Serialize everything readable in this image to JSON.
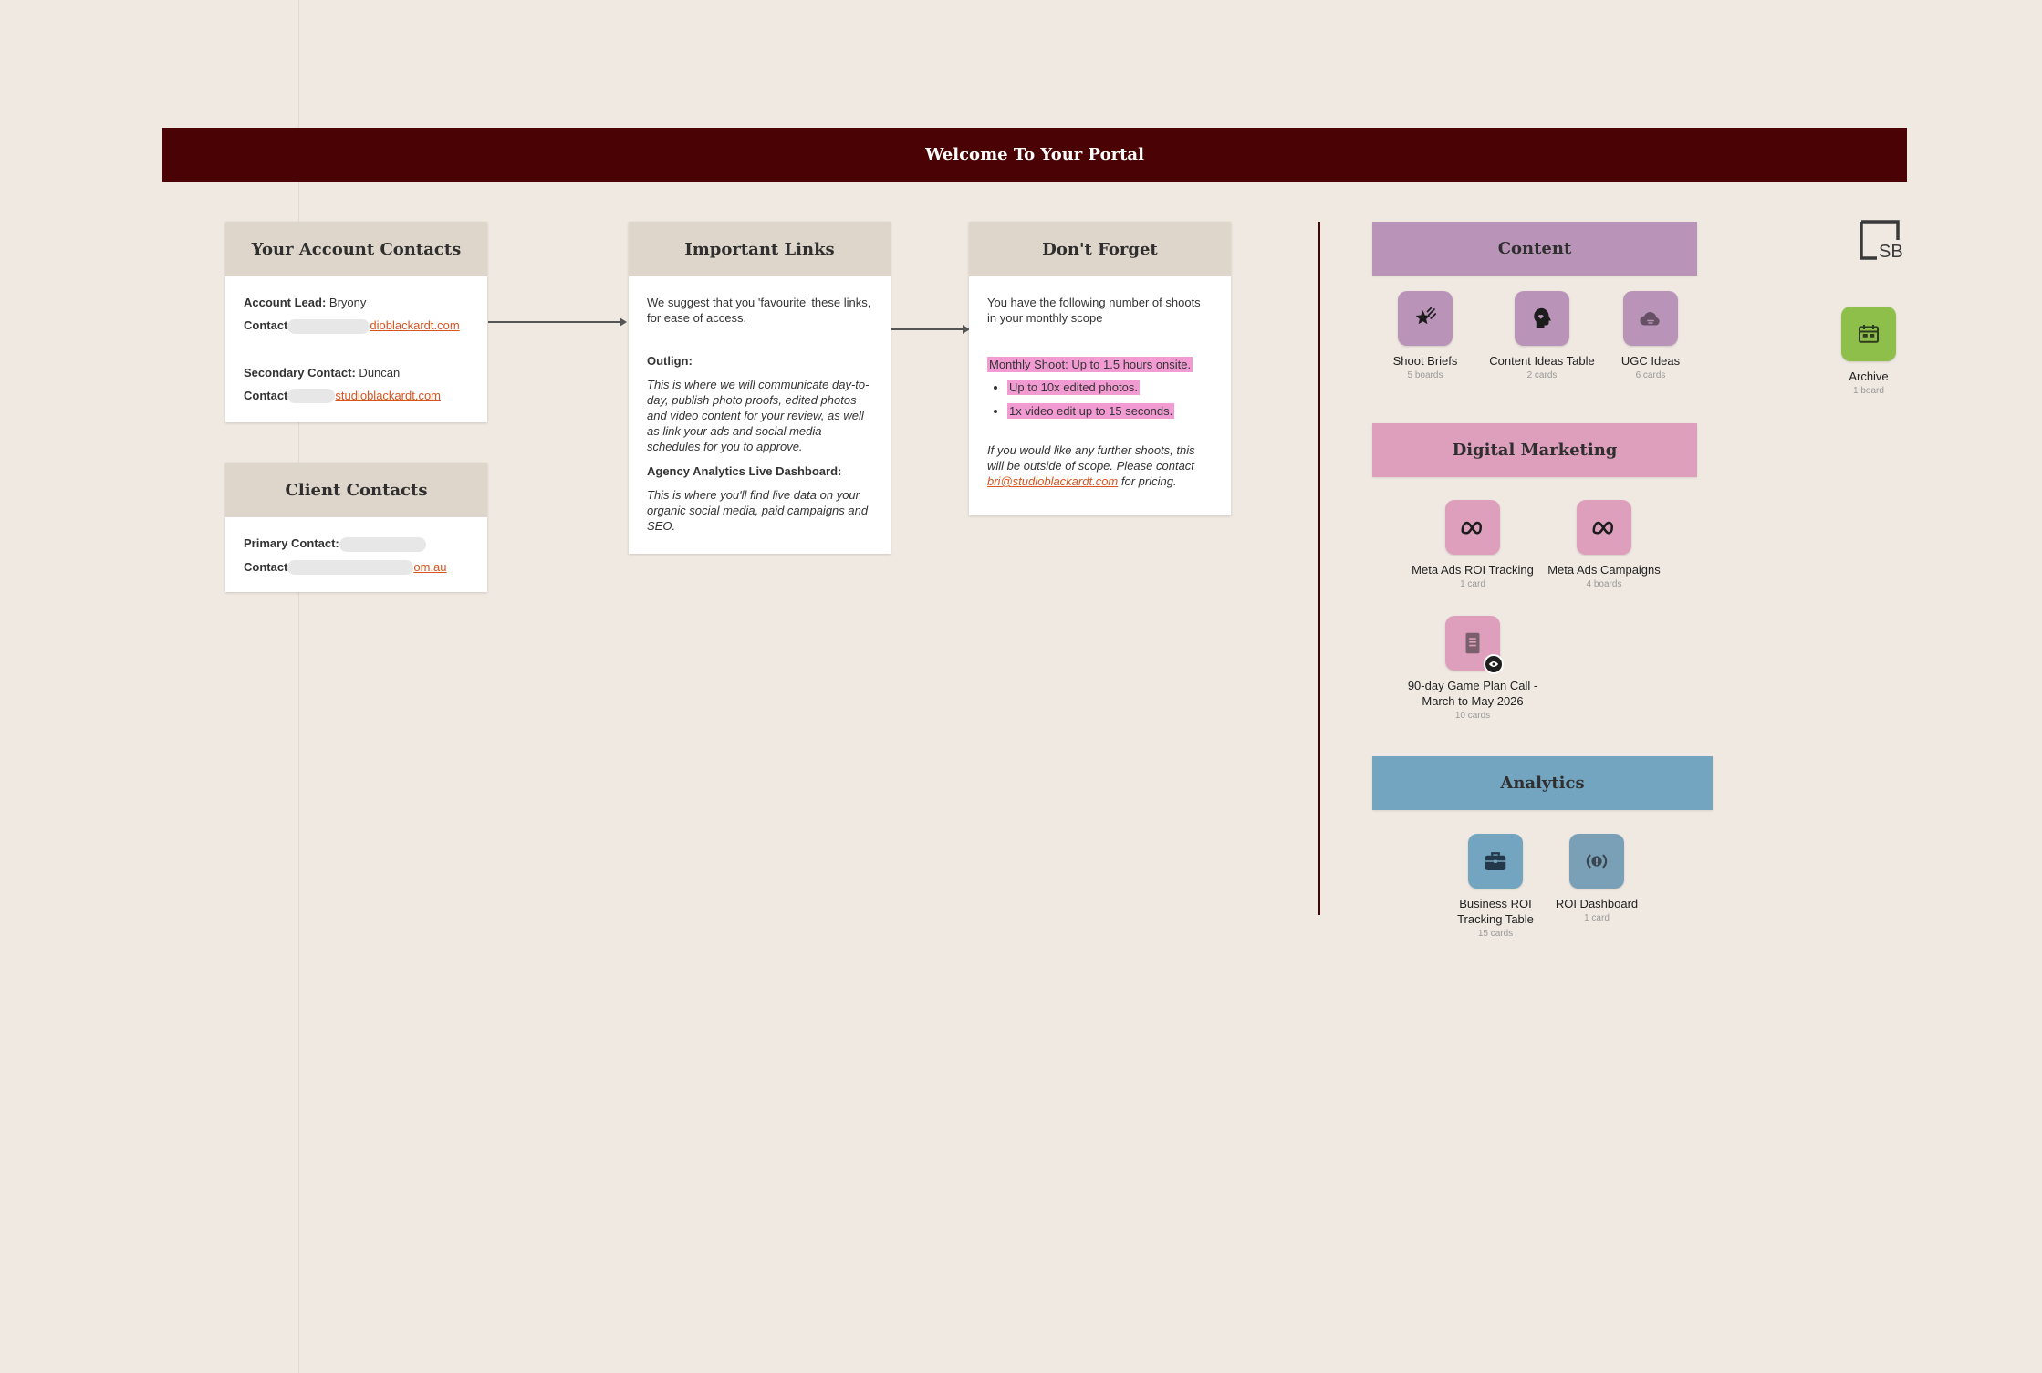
{
  "banner": {
    "title": "Welcome To Your Portal"
  },
  "account_contacts": {
    "title": "Your Account Contacts",
    "lead_label": "Account Lead:",
    "lead_value": " Bryony",
    "contact1_label": "Contact",
    "contact1_email": "dioblackardt.com",
    "secondary_label": "Secondary Contact:",
    "secondary_value": " Duncan",
    "contact2_label": "Contact",
    "contact2_email": "studioblackardt.com"
  },
  "client_contacts": {
    "title": "Client Contacts",
    "primary_label": "Primary Contact:",
    "contact_label": "Contact",
    "contact_email": "om.au"
  },
  "important_links": {
    "title": "Important Links",
    "intro": "We suggest that you 'favourite' these links, for ease of access.",
    "outlign_label": "Outlign:",
    "outlign_text": "This is where we will communicate day-to-day, publish photo proofs, edited photos and video content for your review, as well as link your ads and social media schedules for you to approve.",
    "analytics_label": "Agency Analytics Live Dashboard:",
    "analytics_text": "This is where you'll find live data on your organic social media, paid campaigns and SEO."
  },
  "dont_forget": {
    "title": "Don't Forget",
    "intro": "You have the following number of shoots in your monthly scope",
    "highlight": "Monthly Shoot: Up to 1.5 hours onsite.",
    "bullets": [
      "Up to 10x edited photos.",
      "1x video edit up to 15 seconds."
    ],
    "note": "If you would like any further shoots, this will be outside of scope. Please contact ",
    "note_email": "bri@studioblackardt.com",
    "note_tail": " for pricing."
  },
  "sections": {
    "content": "Content",
    "digital_marketing": "Digital Marketing",
    "analytics": "Analytics"
  },
  "tiles": {
    "shoot_briefs": {
      "label": "Shoot Briefs",
      "sub": "5 boards",
      "icon": "star-icon"
    },
    "content_ideas": {
      "label": "Content Ideas Table",
      "sub": "2 cards",
      "icon": "head-heart-icon"
    },
    "ugc_ideas": {
      "label": "UGC Ideas",
      "sub": "6 cards",
      "icon": "cloud-icon"
    },
    "meta_roi": {
      "label": "Meta Ads ROI Tracking",
      "sub": "1 card",
      "icon": "meta-icon"
    },
    "meta_campaigns": {
      "label": "Meta Ads Campaigns",
      "sub": "4 boards",
      "icon": "meta-icon"
    },
    "game_plan": {
      "label": "90-day Game Plan Call - March to May 2026",
      "sub": "10 cards",
      "icon": "document-icon"
    },
    "business_roi": {
      "label": "Business ROI Tracking Table",
      "sub": "15 cards",
      "icon": "briefcase-icon"
    },
    "roi_dashboard": {
      "label": "ROI Dashboard",
      "sub": "1 card",
      "icon": "alert-broadcast-icon"
    },
    "archive": {
      "label": "Archive",
      "sub": "1 board",
      "icon": "archive-icon"
    }
  },
  "logo": {
    "text": "SB"
  },
  "colors": {
    "banner": "#4a0204",
    "content": "#b994b8",
    "digital_marketing": "#dd9fbc",
    "analytics": "#74a5c0",
    "archive": "#8fbf4b",
    "link": "#d9531e",
    "highlight": "#f29bd3"
  }
}
